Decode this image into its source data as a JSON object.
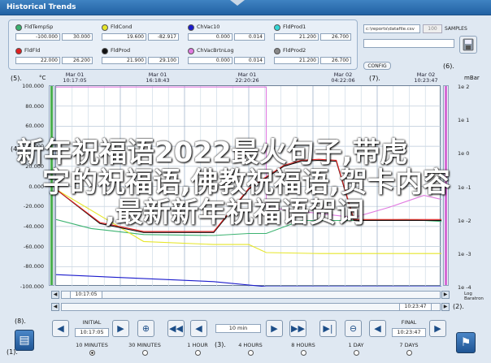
{
  "window": {
    "title": "Historical Trends"
  },
  "channels": [
    {
      "name": "FldTempSp",
      "low": "-100.000",
      "high": "30.000",
      "color": "#3cb371"
    },
    {
      "name": "FldCond",
      "low": "19.600",
      "high": "-82.917",
      "color": "#e6e62a"
    },
    {
      "name": "ChVac10",
      "low": "0.000",
      "high": "0.014",
      "color": "#1a1acc"
    },
    {
      "name": "FldProd1",
      "low": "21.200",
      "high": "26.700",
      "color": "#35d6d6"
    },
    {
      "name": "FldFld",
      "low": "22.000",
      "high": "26.200",
      "color": "#e02020"
    },
    {
      "name": "FldProd",
      "low": "21.900",
      "high": "29.100",
      "color": "#111111"
    },
    {
      "name": "ChVacBrtnLog",
      "low": "0.000",
      "high": "0.014",
      "color": "#e07ae0"
    },
    {
      "name": "FldProd2",
      "low": "21.200",
      "high": "26.700",
      "color": "#888888"
    }
  ],
  "controls": {
    "path_value": "c:\\reports\\datafile.csv",
    "samples_value": "100",
    "samples_label": "SAMPLES",
    "config_label": "CONFIG"
  },
  "callouts": {
    "c1": "(1).",
    "c2": "(2).",
    "c3": "(3).",
    "c4": "(4).",
    "c5": "(5).",
    "c6": "(6).",
    "c7": "(7).",
    "c8": "(8)."
  },
  "chart": {
    "left_unit": "°C",
    "right_unit": "mBar",
    "headers": [
      {
        "date": "Mar 01",
        "time": "10:17:05"
      },
      {
        "date": "Mar 01",
        "time": "16:18:43"
      },
      {
        "date": "Mar 01",
        "time": "22:20:26"
      },
      {
        "date": "Mar 02",
        "time": "04:22:06"
      },
      {
        "date": "Mar 02",
        "time": "10:23:47"
      }
    ],
    "left_ticks": [
      "100.000",
      "80.000",
      "60.000",
      "40.000",
      "20.000",
      "0.000",
      "-20.000",
      "-40.000",
      "-60.000",
      "-80.000",
      "-100.000"
    ],
    "right_ticks": [
      "1e 2",
      "1e 1",
      "1e 0",
      "1e -1",
      "1e -2",
      "1e -3",
      "1e -4"
    ],
    "right_footer": "Log Baratron",
    "start_time": "10:17:05",
    "end_time": "10:23:47"
  },
  "chart_data": {
    "type": "line",
    "series": [
      {
        "name": "FldTempSp",
        "color": "#3cb371",
        "points": [
          [
            0,
            -33
          ],
          [
            4,
            -42
          ],
          [
            10,
            -48
          ],
          [
            18,
            -49
          ],
          [
            22,
            -47
          ],
          [
            24,
            -47
          ],
          [
            28,
            -34
          ],
          [
            30,
            -34
          ],
          [
            34,
            -34
          ],
          [
            40,
            -33
          ],
          [
            44,
            -35
          ]
        ]
      },
      {
        "name": "FldCond",
        "color": "#e6e62a",
        "points": [
          [
            0,
            -3
          ],
          [
            10,
            -55
          ],
          [
            18,
            -58
          ],
          [
            22,
            -58
          ],
          [
            24,
            -66
          ],
          [
            30,
            -67
          ],
          [
            40,
            -67
          ],
          [
            44,
            -67
          ]
        ]
      },
      {
        "name": "ChVac10",
        "color": "#1a1acc",
        "points": [
          [
            0,
            -88
          ],
          [
            18,
            -95
          ],
          [
            24,
            -100
          ],
          [
            44,
            -100
          ]
        ]
      },
      {
        "name": "ChVacBrtnLog",
        "color": "#e07ae0",
        "points": [
          [
            0,
            99
          ],
          [
            24,
            99
          ],
          [
            24,
            -21
          ],
          [
            34,
            -31
          ],
          [
            38,
            -21
          ],
          [
            42,
            -9
          ],
          [
            44,
            -13
          ]
        ]
      },
      {
        "name": "FldProd",
        "color": "#111111",
        "points": [
          [
            0,
            -3
          ],
          [
            5,
            -37
          ],
          [
            10,
            -46
          ],
          [
            18,
            -46
          ],
          [
            22,
            -3
          ],
          [
            26,
            20
          ],
          [
            28,
            25
          ],
          [
            30,
            26
          ],
          [
            32,
            25
          ],
          [
            34,
            -34
          ],
          [
            44,
            -34
          ]
        ]
      },
      {
        "name": "FldFld",
        "color": "#e02020",
        "points": [
          [
            0,
            -3
          ],
          [
            5,
            -36
          ],
          [
            10,
            -45
          ],
          [
            18,
            -45
          ],
          [
            22,
            -2
          ],
          [
            26,
            21
          ],
          [
            28,
            26
          ],
          [
            30,
            27
          ],
          [
            32,
            26
          ],
          [
            34,
            -33
          ],
          [
            44,
            -33
          ]
        ]
      }
    ],
    "x_start": "10:17:05",
    "x_end": "10:23:47",
    "ylim": [
      -100,
      100
    ],
    "grid": true
  },
  "navigation": {
    "initial_label": "INITIAL",
    "initial_time": "10:17:05",
    "step_value": "10 min",
    "final_label": "FINAL",
    "final_time": "10:23:47",
    "ranges": [
      "10 MINUTES",
      "30 MINUTES",
      "1 HOUR",
      "4 HOURS",
      "8 HOURS",
      "1 DAY",
      "7 DAYS"
    ],
    "selected_range": "10 MINUTES"
  },
  "overlay": {
    "line1": "新年祝福语2022最火句子,带虎",
    "line2": "字的祝福语,佛教祝福语,贺卡内容",
    "line3": ",最新新年祝福语贺词"
  }
}
